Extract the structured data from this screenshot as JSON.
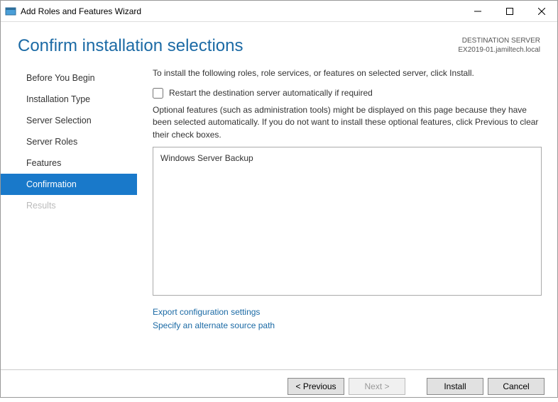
{
  "window": {
    "title": "Add Roles and Features Wizard"
  },
  "header": {
    "title": "Confirm installation selections",
    "dest_label": "DESTINATION SERVER",
    "dest_value": "EX2019-01.jamiltech.local"
  },
  "sidebar": {
    "items": [
      {
        "label": "Before You Begin"
      },
      {
        "label": "Installation Type"
      },
      {
        "label": "Server Selection"
      },
      {
        "label": "Server Roles"
      },
      {
        "label": "Features"
      },
      {
        "label": "Confirmation"
      },
      {
        "label": "Results"
      }
    ]
  },
  "content": {
    "intro": "To install the following roles, role services, or features on selected server, click Install.",
    "restart_label": "Restart the destination server automatically if required",
    "optional_text": "Optional features (such as administration tools) might be displayed on this page because they have been selected automatically. If you do not want to install these optional features, click Previous to clear their check boxes.",
    "features": [
      "Windows Server Backup"
    ],
    "export_link": "Export configuration settings",
    "source_link": "Specify an alternate source path"
  },
  "footer": {
    "previous": "< Previous",
    "next": "Next >",
    "install": "Install",
    "cancel": "Cancel"
  }
}
